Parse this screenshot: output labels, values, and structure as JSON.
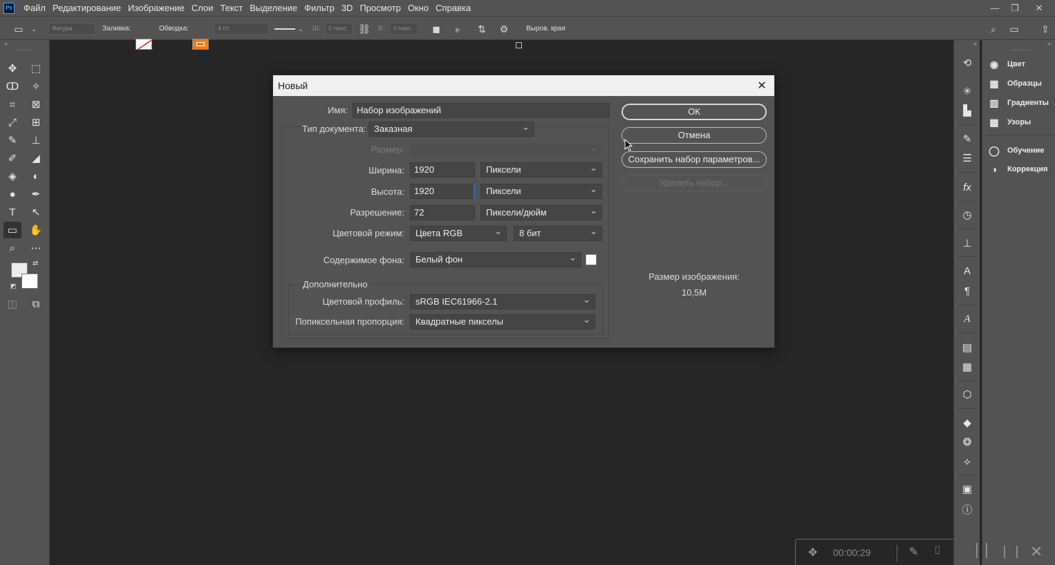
{
  "menubar": {
    "logo": "Ps",
    "items": [
      "Файл",
      "Редактирование",
      "Изображение",
      "Слои",
      "Текст",
      "Выделение",
      "Фильтр",
      "3D",
      "Просмотр",
      "Окно",
      "Справка"
    ]
  },
  "options_bar": {
    "shape_mode": "Фигура",
    "fill_label": "Заливка:",
    "stroke_label": "Обводка:",
    "stroke_width": "4 пт",
    "w_label": "Ш:",
    "w_value": "0 пикс.",
    "h_label": "В:",
    "h_value": "0 пикс.",
    "align_edges_label": "Выров. края",
    "stroke_color": "#f07c14",
    "fill_color": "#ffffff"
  },
  "dialog": {
    "title": "Новый",
    "name_label": "Имя:",
    "name_value": "Набор изображений",
    "doc_type_label": "Тип документа:",
    "doc_type_value": "Заказная",
    "size_label": "Размер:",
    "width_label": "Ширина:",
    "width_value": "1920",
    "width_unit": "Пиксели",
    "height_label": "Высота:",
    "height_value": "1920",
    "height_unit": "Пиксели",
    "resolution_label": "Разрешение:",
    "resolution_value": "72",
    "resolution_unit": "Пиксели/дюйм",
    "color_mode_label": "Цветовой режим:",
    "color_mode_value": "Цвета RGB",
    "bit_depth_value": "8 бит",
    "bg_label": "Содержимое фона:",
    "bg_value": "Белый фон",
    "bg_swatch": "#ffffff",
    "advanced_label": "Дополнительно",
    "profile_label": "Цветовой профиль:",
    "profile_value": "sRGB IEC61966-2.1",
    "pixel_aspect_label": "Попиксельная пропорция:",
    "pixel_aspect_value": "Квадратные пикселы",
    "ok_label": "ОК",
    "cancel_label": "Отмена",
    "save_preset_label": "Сохранить набор параметров...",
    "delete_preset_label": "Удалить набор...",
    "image_size_label": "Размер изображения:",
    "image_size_value": "10,5M"
  },
  "panels": {
    "items": [
      "Цвет",
      "Образцы",
      "Градиенты",
      "Узоры",
      "Обучение",
      "Коррекция"
    ]
  },
  "video_overlay": {
    "timer": "00:00:29"
  }
}
